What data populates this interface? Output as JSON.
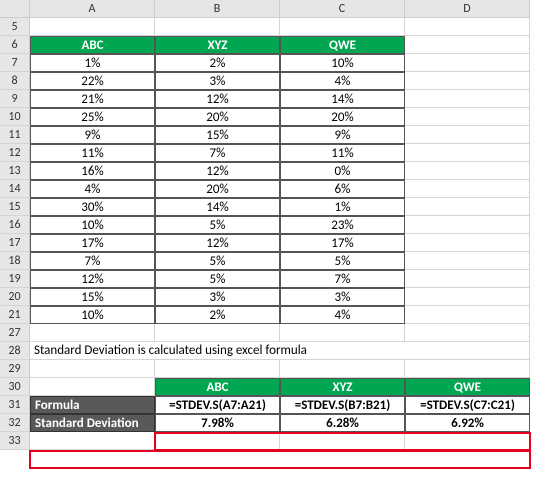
{
  "columns": [
    "A",
    "B",
    "C",
    "D"
  ],
  "row_numbers": [
    "5",
    "6",
    "7",
    "8",
    "9",
    "10",
    "11",
    "12",
    "13",
    "14",
    "15",
    "16",
    "17",
    "18",
    "19",
    "20",
    "21",
    "27",
    "28",
    "29",
    "30",
    "31",
    "32",
    "33"
  ],
  "table1": {
    "headers": [
      "ABC",
      "XYZ",
      "QWE"
    ],
    "rows": [
      [
        "1%",
        "2%",
        "10%"
      ],
      [
        "22%",
        "3%",
        "4%"
      ],
      [
        "21%",
        "12%",
        "14%"
      ],
      [
        "25%",
        "20%",
        "20%"
      ],
      [
        "9%",
        "15%",
        "9%"
      ],
      [
        "11%",
        "7%",
        "11%"
      ],
      [
        "16%",
        "12%",
        "0%"
      ],
      [
        "4%",
        "20%",
        "6%"
      ],
      [
        "30%",
        "14%",
        "1%"
      ],
      [
        "10%",
        "5%",
        "23%"
      ],
      [
        "17%",
        "12%",
        "17%"
      ],
      [
        "7%",
        "5%",
        "5%"
      ],
      [
        "12%",
        "5%",
        "7%"
      ],
      [
        "15%",
        "3%",
        "3%"
      ],
      [
        "10%",
        "2%",
        "4%"
      ]
    ]
  },
  "note": "Standard Deviation is calculated using excel formula",
  "table2": {
    "col_headers": [
      "ABC",
      "XYZ",
      "QWE"
    ],
    "row_labels": [
      "Formula",
      "Standard Deviation"
    ],
    "formula_row": [
      "=STDEV.S(A7:A21)",
      "=STDEV.S(B7:B21)",
      "=STDEV.S(C7:C21)"
    ],
    "result_row": [
      "7.98%",
      "6.28%",
      "6.92%"
    ]
  }
}
